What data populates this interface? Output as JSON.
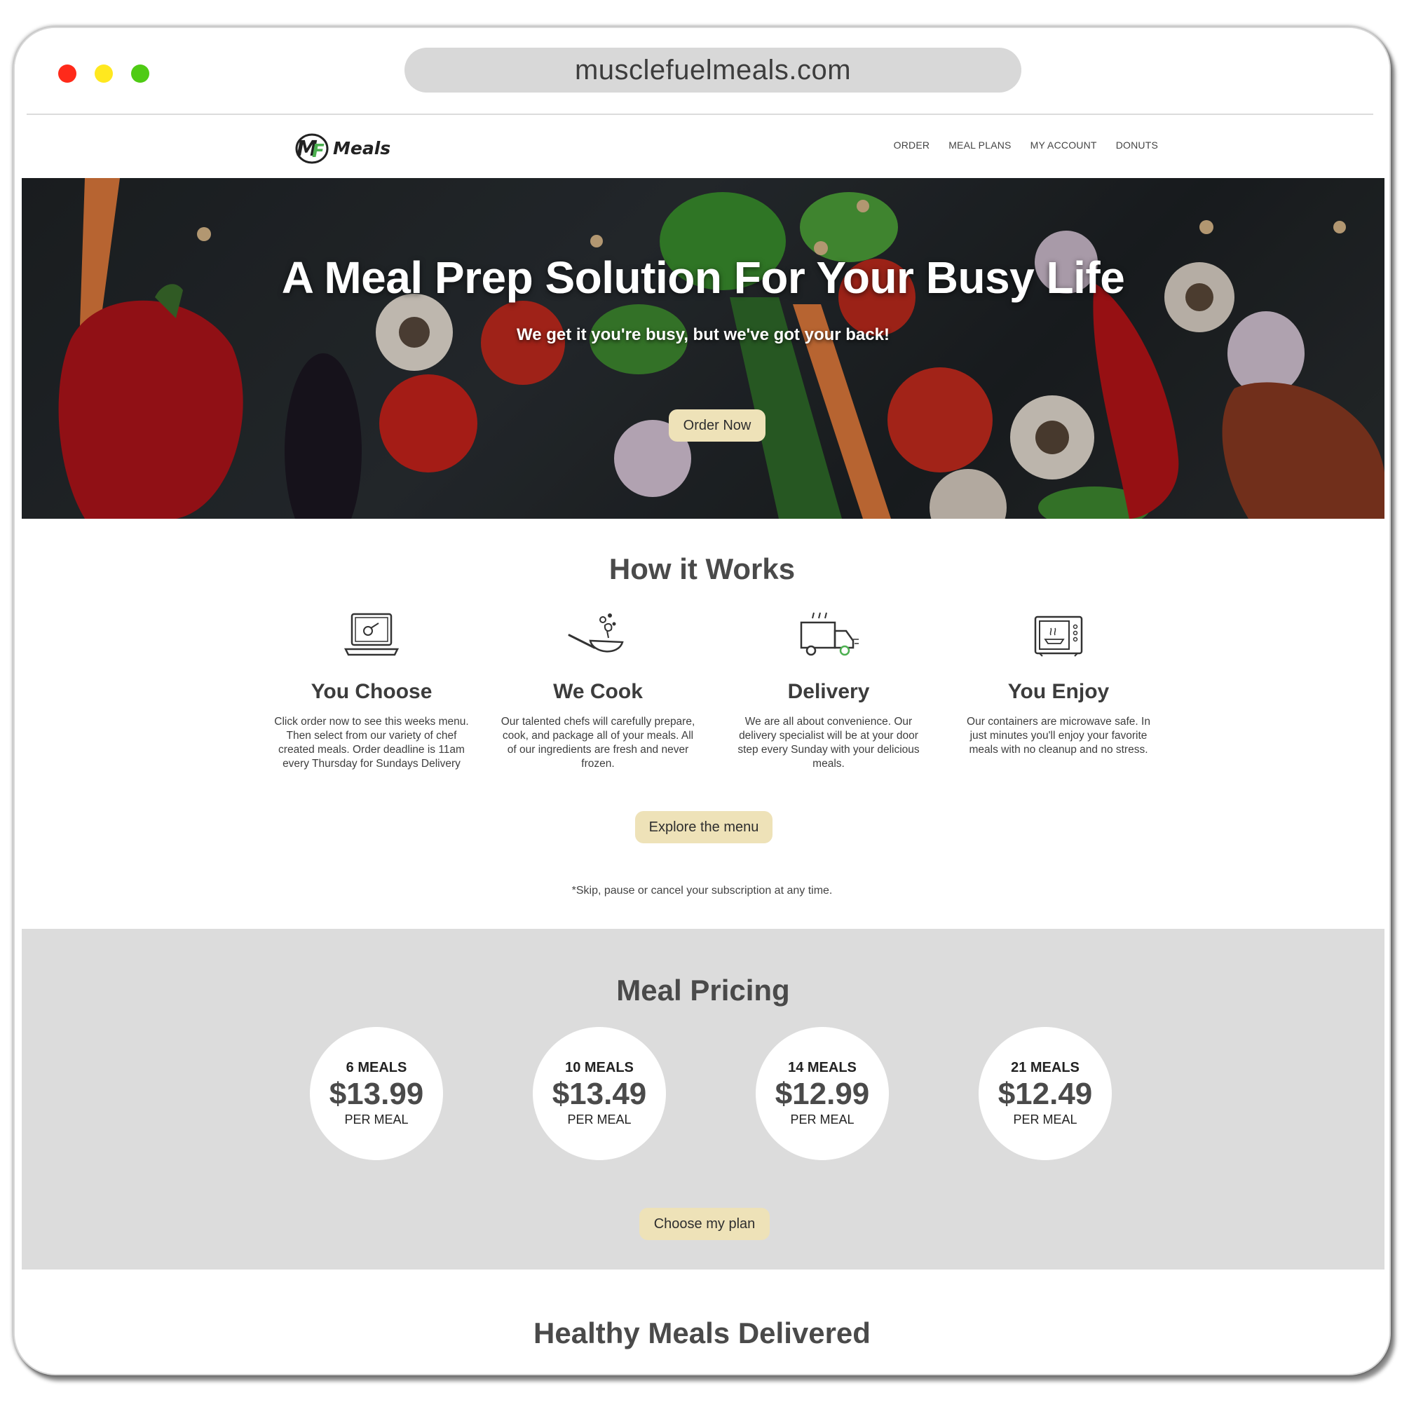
{
  "browser": {
    "url": "musclefuelmeals.com"
  },
  "header": {
    "logo_text": "Meals",
    "nav": [
      "ORDER",
      "MEAL PLANS",
      "MY ACCOUNT",
      "DONUTS"
    ]
  },
  "hero": {
    "title": "A Meal Prep Solution For Your Busy Life",
    "subtitle": "We get it you're busy, but we've got your back!",
    "cta": "Order Now"
  },
  "how_it_works": {
    "title": "How it Works",
    "steps": [
      {
        "icon": "laptop-icon",
        "title": "You Choose",
        "text": "Click order now to see this weeks menu. Then select from our variety of chef created meals. Order deadline is 11am every Thursday for Sundays Delivery"
      },
      {
        "icon": "wok-icon",
        "title": "We Cook",
        "text": "Our talented chefs will carefully prepare, cook, and package all of your meals. All of our ingredients are fresh and never frozen."
      },
      {
        "icon": "delivery-truck-icon",
        "title": "Delivery",
        "text": "We are all about convenience. Our delivery specialist will be at your door step every Sunday with your delicious meals."
      },
      {
        "icon": "microwave-icon",
        "title": "You Enjoy",
        "text": "Our containers are microwave safe. In just minutes you'll enjoy your favorite meals with no cleanup and no stress."
      }
    ],
    "cta": "Explore the menu",
    "note": "*Skip, pause or cancel your subscription at any time."
  },
  "pricing": {
    "title": "Meal Pricing",
    "plans": [
      {
        "count": "6 MEALS",
        "price": "$13.99",
        "per": "PER MEAL"
      },
      {
        "count": "10 MEALS",
        "price": "$13.49",
        "per": "PER MEAL"
      },
      {
        "count": "14 MEALS",
        "price": "$12.99",
        "per": "PER MEAL"
      },
      {
        "count": "21 MEALS",
        "price": "$12.49",
        "per": "PER MEAL"
      }
    ],
    "cta": "Choose my plan"
  },
  "healthy": {
    "title": "Healthy Meals Delivered"
  },
  "colors": {
    "button_bg": "#eee2b8",
    "pricing_bg": "#dcdcdc",
    "logo_green": "#4caf50"
  }
}
